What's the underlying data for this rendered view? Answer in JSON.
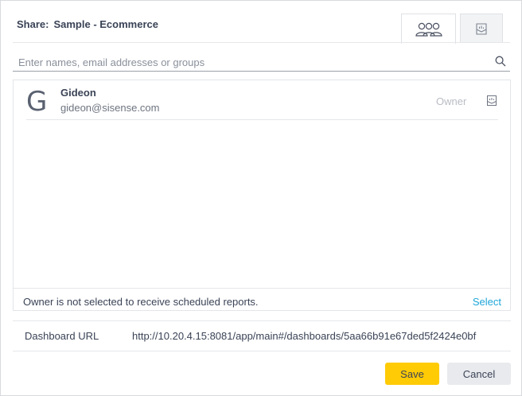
{
  "dialog": {
    "title_prefix": "Share:",
    "title_name": "Sample - Ecommerce",
    "tabs": [
      {
        "icon": "users-icon",
        "active": true
      },
      {
        "icon": "report-icon",
        "active": false
      }
    ]
  },
  "search": {
    "placeholder": "Enter names, email addresses or groups",
    "value": ""
  },
  "users": [
    {
      "initial": "G",
      "name": "Gideon",
      "email": "gideon@sisense.com",
      "role": "Owner",
      "report_icon": "report-icon"
    }
  ],
  "notice": {
    "text": "Owner is not selected to receive scheduled reports.",
    "link": "Select"
  },
  "url": {
    "label": "Dashboard URL",
    "value": "http://10.20.4.15:8081/app/main#/dashboards/5aa66b91e67ded5f2424e0bf"
  },
  "buttons": {
    "save": "Save",
    "cancel": "Cancel"
  },
  "colors": {
    "accent_save": "#ffcb05",
    "link": "#1ea6d8",
    "text": "#3a4356"
  }
}
